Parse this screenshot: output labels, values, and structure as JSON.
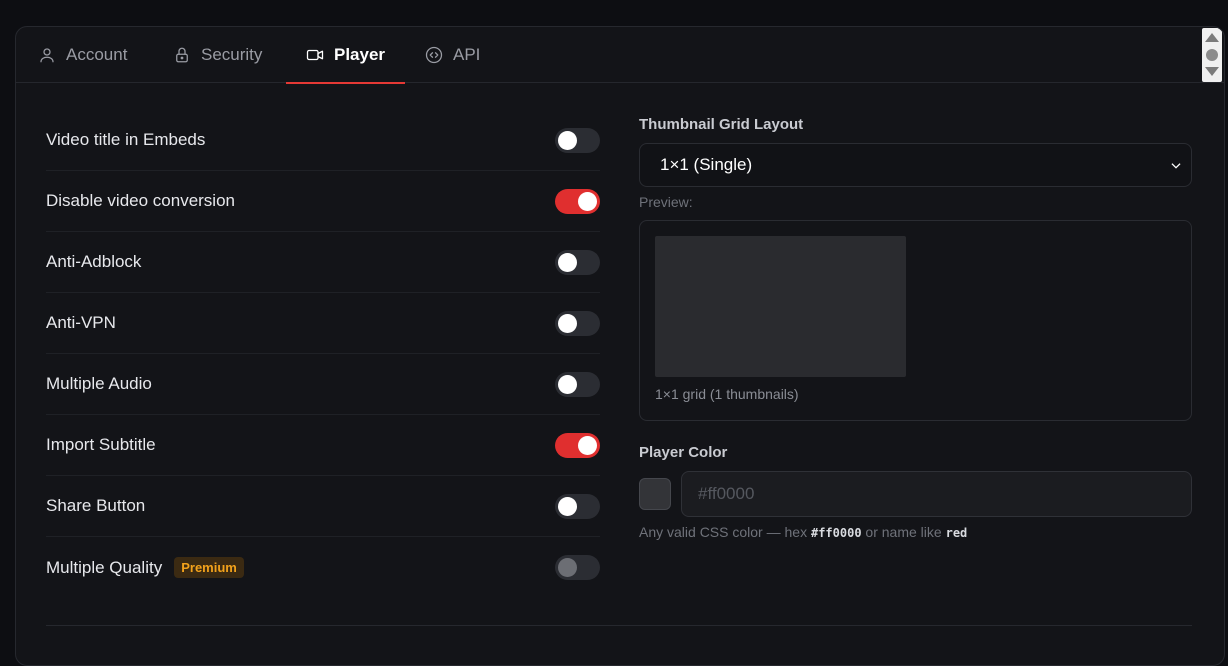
{
  "tabs": [
    {
      "label": "Account",
      "icon": "user-icon",
      "active": false
    },
    {
      "label": "Security",
      "icon": "lock-icon",
      "active": false
    },
    {
      "label": "Player",
      "icon": "video-icon",
      "active": true
    },
    {
      "label": "API",
      "icon": "code-icon",
      "active": false
    }
  ],
  "settings": [
    {
      "label": "Video title in Embeds",
      "enabled": false
    },
    {
      "label": "Disable video conversion",
      "enabled": true
    },
    {
      "label": "Anti-Adblock",
      "enabled": false
    },
    {
      "label": "Anti-VPN",
      "enabled": false
    },
    {
      "label": "Multiple Audio",
      "enabled": false
    },
    {
      "label": "Import Subtitle",
      "enabled": true
    },
    {
      "label": "Share Button",
      "enabled": false
    },
    {
      "label": "Multiple Quality",
      "enabled": false,
      "disabled": true,
      "badge": "Premium"
    }
  ],
  "thumbnail": {
    "label": "Thumbnail Grid Layout",
    "selected": "1×1 (Single)",
    "preview_label": "Preview:",
    "caption": "1×1 grid (1 thumbnails)"
  },
  "player_color": {
    "label": "Player Color",
    "placeholder": "#ff0000",
    "value": "",
    "hint_prefix": "Any valid CSS color — hex ",
    "hint_code1": "#ff0000",
    "hint_mid": " or name like ",
    "hint_code2": "red"
  },
  "colors": {
    "accent": "#e02f2f",
    "premium_badge": "#f3a21b"
  }
}
